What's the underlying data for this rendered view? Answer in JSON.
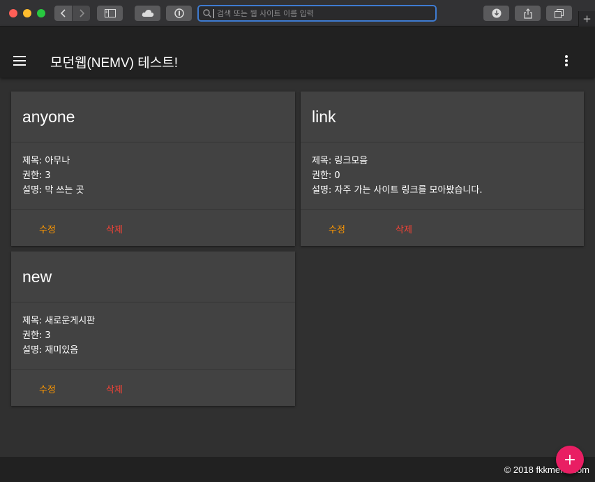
{
  "browser": {
    "address_placeholder": "검색 또는 웹 사이트 이름 입력",
    "new_tab_symbol": "+"
  },
  "appbar": {
    "title": "모던웹(NEMV) 테스트!"
  },
  "boards": [
    {
      "name": "anyone",
      "title_line": "제목: 아무나",
      "level_line": "권한: 3",
      "desc_line": "설명: 막 쓰는 곳",
      "edit_label": "수정",
      "delete_label": "삭제"
    },
    {
      "name": "link",
      "title_line": "제목: 링크모음",
      "level_line": "권한: 0",
      "desc_line": "설명: 자주 가는 사이트 링크를 모아봤습니다.",
      "edit_label": "수정",
      "delete_label": "삭제"
    },
    {
      "name": "new",
      "title_line": "제목: 새로운게시판",
      "level_line": "권한: 3",
      "desc_line": "설명: 재미있음",
      "edit_label": "수정",
      "delete_label": "삭제"
    }
  ],
  "footer": {
    "text": "© 2018 fkkmemi.com"
  },
  "fab": {
    "symbol": "+"
  },
  "colors": {
    "background": "#303030",
    "card": "#424242",
    "appbar": "#212121",
    "edit": "#ff9800",
    "delete": "#f44336",
    "fab": "#e91e63"
  }
}
